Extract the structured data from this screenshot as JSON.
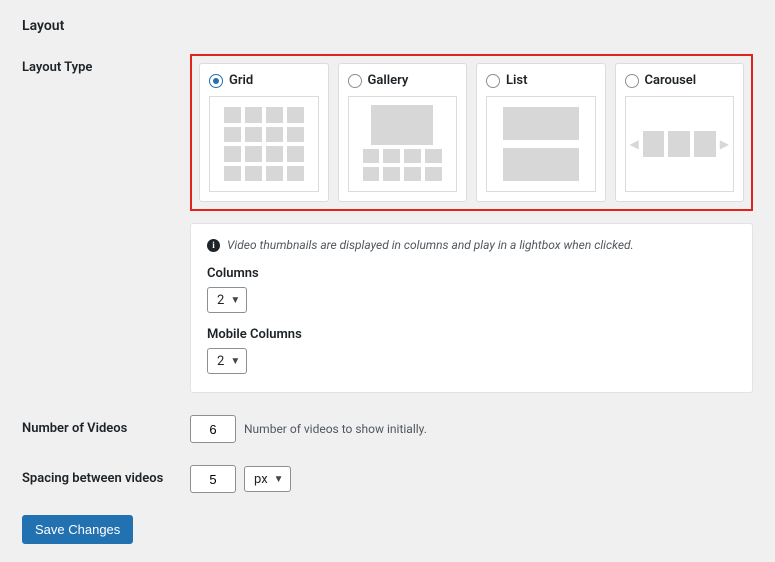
{
  "heading": "Layout",
  "layout_type": {
    "label": "Layout Type",
    "options": [
      {
        "id": "grid",
        "label": "Grid",
        "selected": true
      },
      {
        "id": "gallery",
        "label": "Gallery",
        "selected": false
      },
      {
        "id": "list",
        "label": "List",
        "selected": false
      },
      {
        "id": "carousel",
        "label": "Carousel",
        "selected": false
      }
    ],
    "helper_text": "Video thumbnails are displayed in columns and play in a lightbox when clicked.",
    "columns": {
      "label": "Columns",
      "value": "2"
    },
    "mobile_columns": {
      "label": "Mobile Columns",
      "value": "2"
    }
  },
  "number_of_videos": {
    "label": "Number of Videos",
    "value": "6",
    "help": "Number of videos to show initially."
  },
  "spacing": {
    "label": "Spacing between videos",
    "value": "5",
    "unit": "px"
  },
  "save_label": "Save Changes"
}
